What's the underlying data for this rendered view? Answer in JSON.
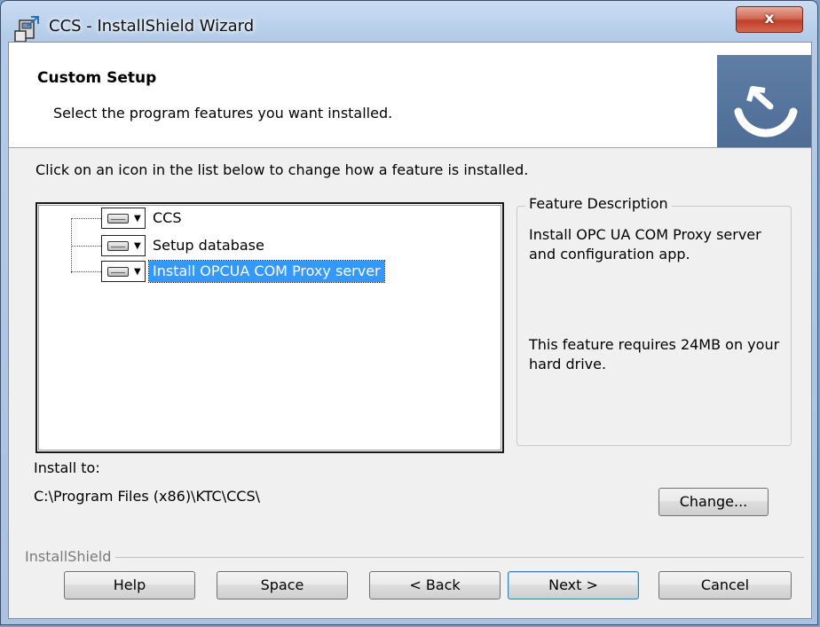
{
  "window": {
    "title": "CCS - InstallShield Wizard",
    "close_label": "x"
  },
  "banner": {
    "title": "Custom Setup",
    "subtitle": "Select the program features you want installed."
  },
  "instruction": "Click on an icon in the list below to change how a feature is installed.",
  "features": [
    {
      "label": "CCS",
      "selected": false
    },
    {
      "label": "Setup database",
      "selected": false
    },
    {
      "label": "Install OPCUA COM Proxy server",
      "selected": true
    }
  ],
  "description": {
    "title": "Feature Description",
    "text": "Install OPC UA COM Proxy server and configuration app.",
    "requirement": "This feature requires 24MB on your hard drive."
  },
  "install_to": {
    "label": "Install to:",
    "path": "C:\\Program Files (x86)\\KTC\\CCS\\"
  },
  "buttons": {
    "change": "Change...",
    "help": "Help",
    "space": "Space",
    "back": "< Back",
    "next": "Next >",
    "cancel": "Cancel"
  },
  "footer_brand": "InstallShield",
  "icons": {
    "feature_icon": "hard-drive-icon",
    "dropdown": "dropdown-arrow-icon",
    "title_icon": "installer-icon",
    "banner_logo": "installshield-logo-icon"
  }
}
